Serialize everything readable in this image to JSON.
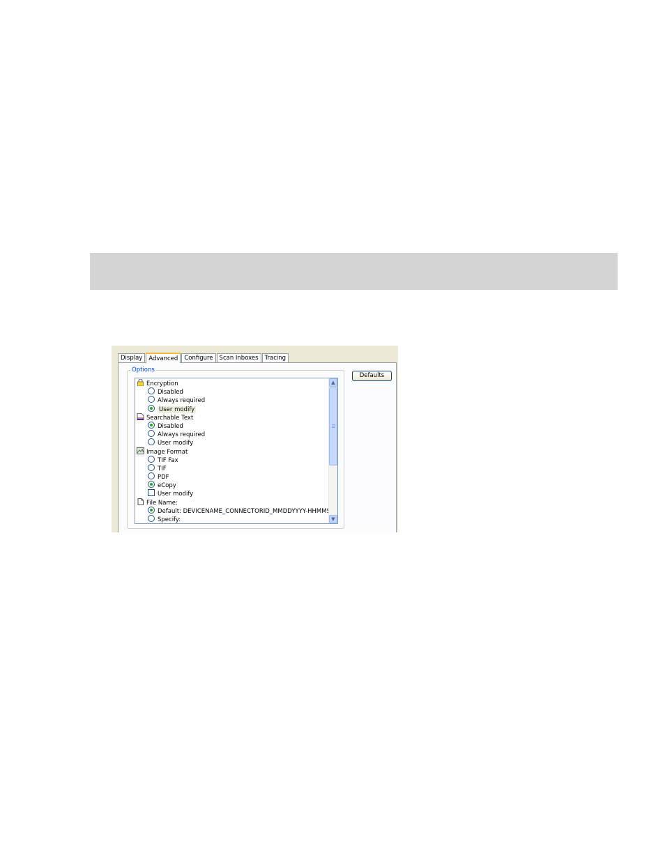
{
  "tabs": [
    {
      "label": "Display",
      "active": false
    },
    {
      "label": "Advanced",
      "active": true
    },
    {
      "label": "Configure",
      "active": false
    },
    {
      "label": "Scan Inboxes",
      "active": false
    },
    {
      "label": "Tracing",
      "active": false
    }
  ],
  "options_group": {
    "legend": "Options",
    "items": [
      {
        "kind": "category",
        "label": "Encryption",
        "icon": "lock-icon"
      },
      {
        "kind": "radio",
        "label": "Disabled",
        "checked": false
      },
      {
        "kind": "radio",
        "label": "Always required",
        "checked": false
      },
      {
        "kind": "radio",
        "label": "User modify",
        "checked": true,
        "highlighted": true
      },
      {
        "kind": "category",
        "label": "Searchable Text",
        "icon": "document-text-icon"
      },
      {
        "kind": "radio",
        "label": "Disabled",
        "checked": true
      },
      {
        "kind": "radio",
        "label": "Always required",
        "checked": false
      },
      {
        "kind": "radio",
        "label": "User modify",
        "checked": false
      },
      {
        "kind": "category",
        "label": "Image Format",
        "icon": "image-icon"
      },
      {
        "kind": "radio",
        "label": "TIF Fax",
        "checked": false
      },
      {
        "kind": "radio",
        "label": "TIF",
        "checked": false
      },
      {
        "kind": "radio",
        "label": "PDF",
        "checked": false
      },
      {
        "kind": "radio",
        "label": "eCopy",
        "checked": true
      },
      {
        "kind": "checkbox",
        "label": "User modify",
        "checked": false
      },
      {
        "kind": "category",
        "label": "File Name:",
        "icon": "file-icon"
      },
      {
        "kind": "radio",
        "label": "Default: DEVICENAME_CONNECTORID_MMDDYYYY-HHMMSS",
        "checked": true
      },
      {
        "kind": "radio",
        "label": "Specify:",
        "checked": false
      }
    ]
  },
  "defaults_button": {
    "label": "Defaults"
  },
  "colors": {
    "legend": "#0046d5",
    "tab_active_accent": "#f5b73a",
    "radio_dot": "#21a121"
  }
}
